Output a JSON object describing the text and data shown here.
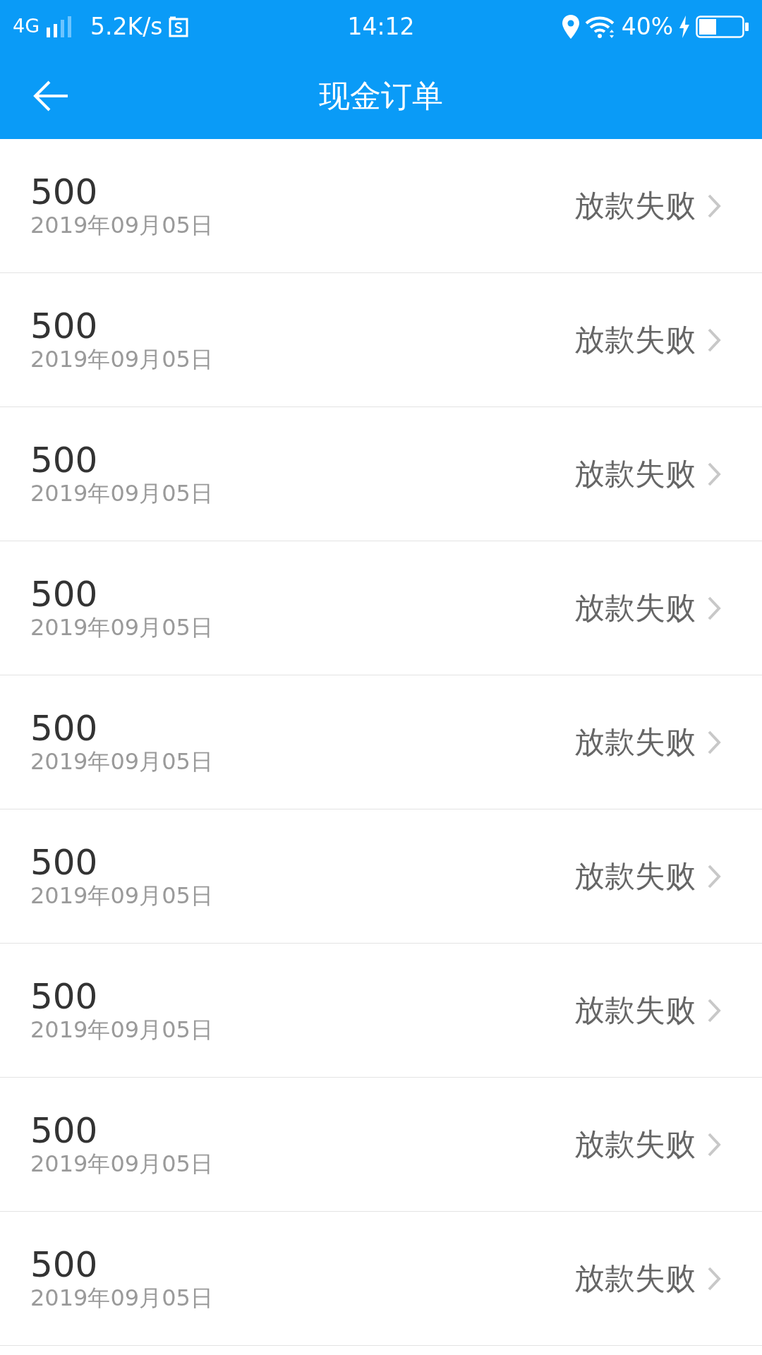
{
  "status_bar": {
    "network": "4G",
    "speed": "5.2K/s",
    "time": "14:12",
    "battery": "40%"
  },
  "header": {
    "title": "现金订单"
  },
  "orders": [
    {
      "amount": "500",
      "date": "2019年09月05日",
      "status": "放款失败"
    },
    {
      "amount": "500",
      "date": "2019年09月05日",
      "status": "放款失败"
    },
    {
      "amount": "500",
      "date": "2019年09月05日",
      "status": "放款失败"
    },
    {
      "amount": "500",
      "date": "2019年09月05日",
      "status": "放款失败"
    },
    {
      "amount": "500",
      "date": "2019年09月05日",
      "status": "放款失败"
    },
    {
      "amount": "500",
      "date": "2019年09月05日",
      "status": "放款失败"
    },
    {
      "amount": "500",
      "date": "2019年09月05日",
      "status": "放款失败"
    },
    {
      "amount": "500",
      "date": "2019年09月05日",
      "status": "放款失败"
    },
    {
      "amount": "500",
      "date": "2019年09月05日",
      "status": "放款失败"
    }
  ]
}
